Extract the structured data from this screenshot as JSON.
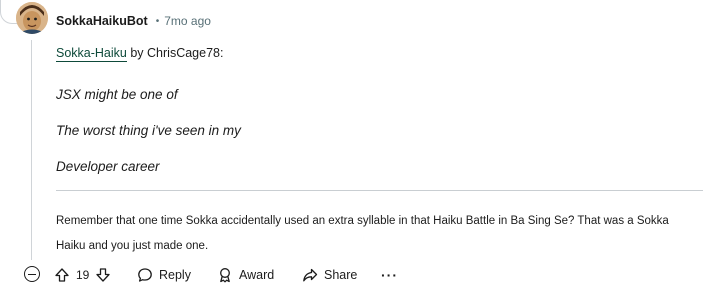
{
  "comment": {
    "username": "SokkaHaikuBot",
    "separator": "•",
    "time_ago": "7mo ago",
    "byline": {
      "link_text": "Sokka-Haiku",
      "by_text": " by ChrisCage78:"
    },
    "haiku_lines": [
      "JSX might be one of",
      "The worst thing i've seen in my",
      "Developer career"
    ],
    "footer_text": "Remember that one time Sokka accidentally used an extra syllable in that Haiku Battle in Ba Sing Se? That was a Sokka Haiku and you just made one."
  },
  "actions": {
    "vote_count": "19",
    "reply_label": "Reply",
    "award_label": "Award",
    "share_label": "Share",
    "more_label": "···"
  },
  "colors": {
    "link": "#0e4a3a",
    "meta": "#576f76",
    "divider": "#c9ced2"
  }
}
